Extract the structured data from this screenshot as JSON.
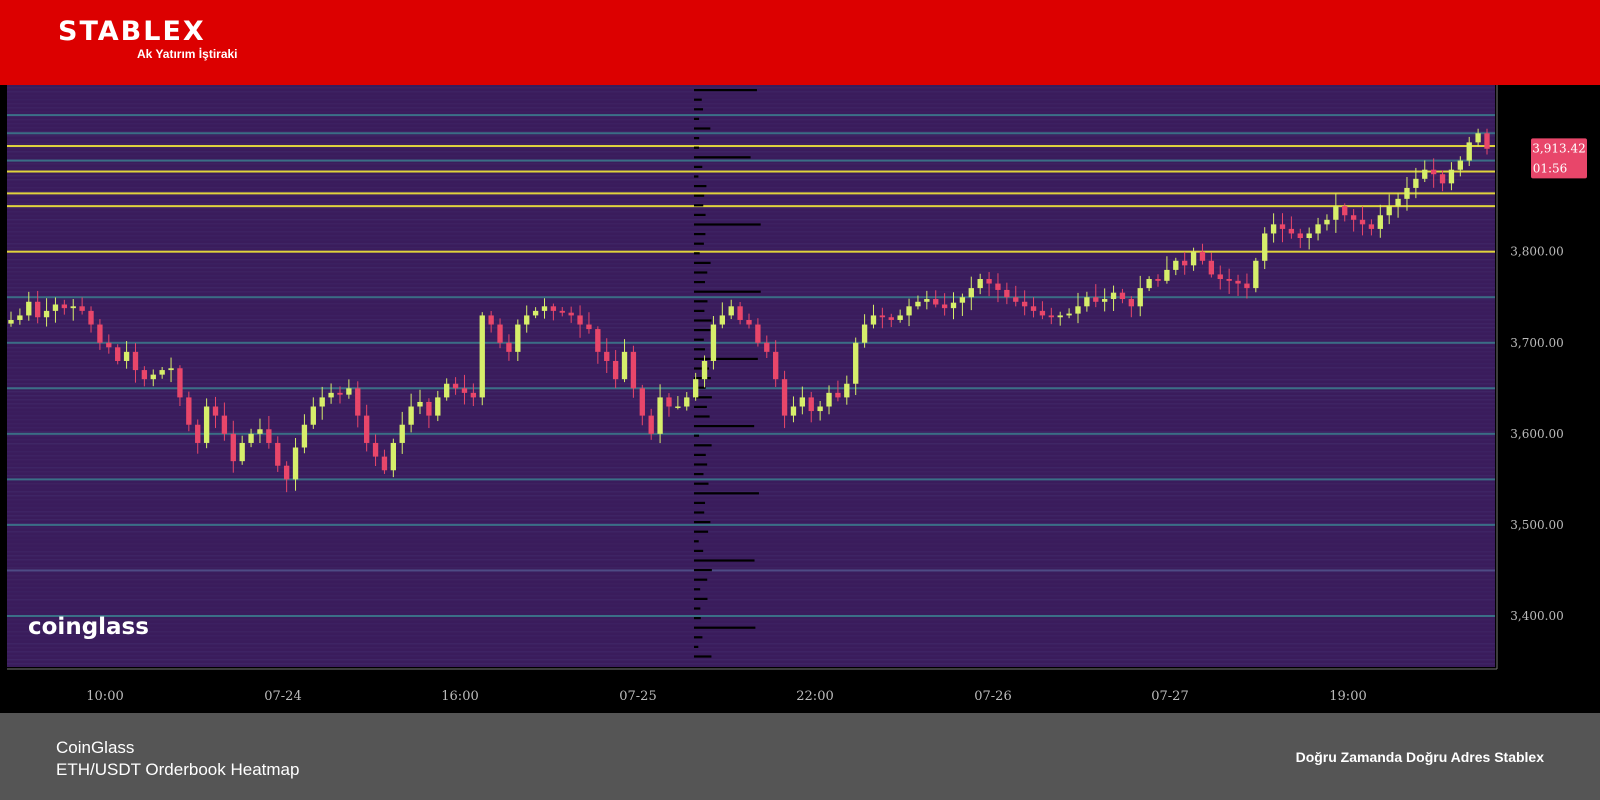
{
  "brand": {
    "name": "STABLEX",
    "tagline": "Ak Yatırım İştiraki"
  },
  "watermark": "coinglass",
  "footer": {
    "source": "CoinGlass",
    "title": "ETH/USDT Orderbook Heatmap",
    "slogan": "Doğru Zamanda Doğru Adres Stablex"
  },
  "colors": {
    "brand_red": "#dc0000",
    "heatmap_bg": "#3a1c5c",
    "candle_up": "#d7ee6b",
    "candle_down": "#e8466a",
    "level_mid": "#3aa3a0",
    "level_high": "#f2e83a",
    "footer_bg": "#555555",
    "price_tag": "#e8466a"
  },
  "chart_data": {
    "type": "heatmap",
    "title": "ETH/USDT Orderbook Heatmap",
    "xlabel": "",
    "ylabel": "",
    "x_tick_labels": [
      "10:00",
      "07-24",
      "16:00",
      "07-25",
      "22:00",
      "07-26",
      "07-27",
      "19:00"
    ],
    "y_tick_labels": [
      "3,800.00",
      "3,700.00",
      "3,600.00",
      "3,500.00",
      "3,400.00"
    ],
    "ylim": [
      3344,
      3983
    ],
    "current_price_label": "3,913.42",
    "countdown_label": "01:56",
    "current_price": 3913.42,
    "grid": false,
    "orderbook_levels": [
      {
        "price": 3950,
        "strength": "mid"
      },
      {
        "price": 3930,
        "strength": "mid"
      },
      {
        "price": 3916,
        "strength": "high"
      },
      {
        "price": 3900,
        "strength": "mid"
      },
      {
        "price": 3888,
        "strength": "high"
      },
      {
        "price": 3864,
        "strength": "high"
      },
      {
        "price": 3850,
        "strength": "high"
      },
      {
        "price": 3800,
        "strength": "high"
      },
      {
        "price": 3750,
        "strength": "mid"
      },
      {
        "price": 3700,
        "strength": "mid"
      },
      {
        "price": 3650,
        "strength": "mid"
      },
      {
        "price": 3600,
        "strength": "mid"
      },
      {
        "price": 3550,
        "strength": "mid"
      },
      {
        "price": 3500,
        "strength": "mid"
      },
      {
        "price": 3450,
        "strength": "low"
      },
      {
        "price": 3400,
        "strength": "mid"
      }
    ],
    "closes": [
      3725,
      3730,
      3745,
      3728,
      3735,
      3742,
      3738,
      3740,
      3735,
      3720,
      3700,
      3695,
      3680,
      3690,
      3670,
      3660,
      3665,
      3670,
      3672,
      3640,
      3610,
      3590,
      3630,
      3620,
      3600,
      3570,
      3590,
      3600,
      3605,
      3590,
      3565,
      3550,
      3585,
      3610,
      3630,
      3640,
      3645,
      3643,
      3650,
      3620,
      3590,
      3575,
      3560,
      3590,
      3610,
      3630,
      3635,
      3620,
      3640,
      3655,
      3650,
      3645,
      3640,
      3730,
      3720,
      3700,
      3690,
      3720,
      3730,
      3735,
      3740,
      3735,
      3733,
      3730,
      3720,
      3715,
      3690,
      3680,
      3660,
      3690,
      3650,
      3620,
      3600,
      3640,
      3630,
      3630,
      3640,
      3660,
      3680,
      3720,
      3730,
      3740,
      3725,
      3720,
      3700,
      3690,
      3660,
      3620,
      3630,
      3640,
      3625,
      3630,
      3645,
      3640,
      3655,
      3700,
      3720,
      3730,
      3728,
      3725,
      3730,
      3740,
      3745,
      3748,
      3742,
      3738,
      3744,
      3750,
      3760,
      3770,
      3765,
      3758,
      3750,
      3745,
      3740,
      3735,
      3730,
      3728,
      3730,
      3732,
      3740,
      3750,
      3745,
      3748,
      3755,
      3748,
      3740,
      3760,
      3770,
      3768,
      3780,
      3790,
      3785,
      3800,
      3790,
      3775,
      3770,
      3768,
      3765,
      3760,
      3790,
      3820,
      3830,
      3825,
      3820,
      3815,
      3820,
      3830,
      3835,
      3850,
      3840,
      3835,
      3830,
      3825,
      3840,
      3850,
      3858,
      3870,
      3880,
      3890,
      3885,
      3875,
      3890,
      3900,
      3920,
      3930,
      3913
    ]
  }
}
